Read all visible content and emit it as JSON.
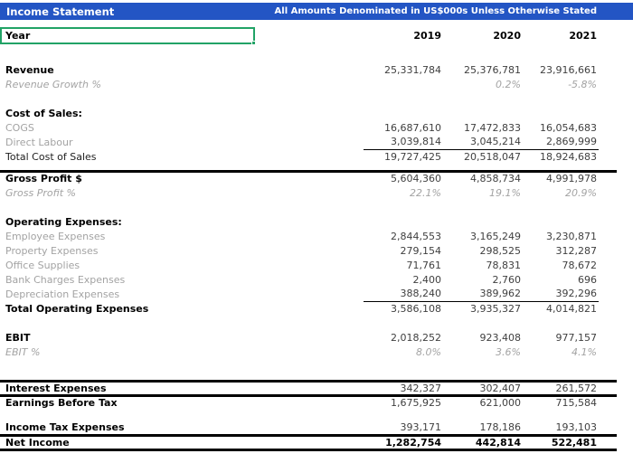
{
  "title_bar": {
    "title": "Income Statement",
    "note": "All Amounts Denominated in US$000s Unless Otherwise Stated"
  },
  "colors": {
    "header_bg": "#2355C4",
    "selection_green": "#21A366"
  },
  "year_header": {
    "label": "Year",
    "columns": [
      "2019",
      "2020",
      "2021"
    ]
  },
  "rows": [
    {
      "label": "Revenue",
      "values": [
        "25,331,784",
        "25,376,781",
        "23,916,661"
      ]
    },
    {
      "label": "Revenue Growth %",
      "values": [
        "",
        "0.2%",
        "-5.8%"
      ]
    },
    {
      "label": "Cost of Sales:",
      "values": [
        "",
        "",
        ""
      ]
    },
    {
      "label": "COGS",
      "values": [
        "16,687,610",
        "17,472,833",
        "16,054,683"
      ]
    },
    {
      "label": "Direct Labour",
      "values": [
        "3,039,814",
        "3,045,214",
        "2,869,999"
      ]
    },
    {
      "label": "Total Cost of Sales",
      "values": [
        "19,727,425",
        "20,518,047",
        "18,924,683"
      ]
    },
    {
      "label": "Gross Profit $",
      "values": [
        "5,604,360",
        "4,858,734",
        "4,991,978"
      ]
    },
    {
      "label": "Gross Profit %",
      "values": [
        "22.1%",
        "19.1%",
        "20.9%"
      ]
    },
    {
      "label": "Operating Expenses:",
      "values": [
        "",
        "",
        ""
      ]
    },
    {
      "label": "Employee Expenses",
      "values": [
        "2,844,553",
        "3,165,249",
        "3,230,871"
      ]
    },
    {
      "label": "Property Expenses",
      "values": [
        "279,154",
        "298,525",
        "312,287"
      ]
    },
    {
      "label": "Office Supplies",
      "values": [
        "71,761",
        "78,831",
        "78,672"
      ]
    },
    {
      "label": "Bank Charges Expenses",
      "values": [
        "2,400",
        "2,760",
        "696"
      ]
    },
    {
      "label": "Depreciation Expenses",
      "values": [
        "388,240",
        "389,962",
        "392,296"
      ]
    },
    {
      "label": "Total Operating Expenses",
      "values": [
        "3,586,108",
        "3,935,327",
        "4,014,821"
      ]
    },
    {
      "label": "EBIT",
      "values": [
        "2,018,252",
        "923,408",
        "977,157"
      ]
    },
    {
      "label": "EBIT %",
      "values": [
        "8.0%",
        "3.6%",
        "4.1%"
      ]
    },
    {
      "label": "Interest Expenses",
      "values": [
        "342,327",
        "302,407",
        "261,572"
      ]
    },
    {
      "label": "Earnings Before Tax",
      "values": [
        "1,675,925",
        "621,000",
        "715,584"
      ]
    },
    {
      "label": "Income Tax Expenses",
      "values": [
        "393,171",
        "178,186",
        "193,103"
      ]
    },
    {
      "label": "Net Income",
      "values": [
        "1,282,754",
        "442,814",
        "522,481"
      ]
    }
  ]
}
